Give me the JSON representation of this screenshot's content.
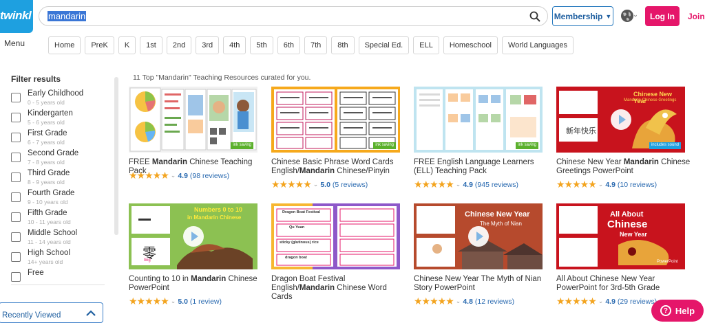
{
  "header": {
    "logo_text": "twinkl",
    "search_value": "mandarin",
    "membership_label": "Membership",
    "login_label": "Log In",
    "join_label": "Join",
    "menu_label": "Menu"
  },
  "grades": [
    "Home",
    "PreK",
    "K",
    "1st",
    "2nd",
    "3rd",
    "4th",
    "5th",
    "6th",
    "7th",
    "8th",
    "Special Ed.",
    "ELL",
    "Homeschool",
    "World Languages"
  ],
  "sidebar": {
    "filter_title": "Filter results",
    "filters": [
      {
        "label": "Early Childhood",
        "sub": "0 - 5 years old"
      },
      {
        "label": "Kindergarten",
        "sub": "5 - 6 years old"
      },
      {
        "label": "First Grade",
        "sub": "6 - 7 years old"
      },
      {
        "label": "Second Grade",
        "sub": "7 - 8 years old"
      },
      {
        "label": "Third Grade",
        "sub": "8 - 9 years old"
      },
      {
        "label": "Fourth Grade",
        "sub": "9 - 10 years old"
      },
      {
        "label": "Fifth Grade",
        "sub": "10 - 11 years old"
      },
      {
        "label": "Middle School",
        "sub": "11 - 14 years old"
      },
      {
        "label": "High School",
        "sub": "14+ years old"
      },
      {
        "label": "Free",
        "sub": ""
      }
    ],
    "recently_viewed": "Recently Viewed"
  },
  "results": {
    "count_text": "11 Top \"Mandarin\" Teaching Resources curated for you.",
    "cards": [
      {
        "pre": "FREE ",
        "bold": "Mandarin",
        "post": " Chinese Teaching Pack",
        "score": "4.9",
        "reviews": "(98 reviews)",
        "badge": "ink saving"
      },
      {
        "pre": "Chinese Basic Phrase Word Cards English/",
        "bold": "Mandarin",
        "post": " Chinese/Pinyin",
        "score": "5.0",
        "reviews": "(5 reviews)",
        "badge": "ink saving"
      },
      {
        "pre": "FREE English Language Learners (ELL) Teaching Pack",
        "bold": "",
        "post": "",
        "score": "4.9",
        "reviews": "(945 reviews)",
        "badge": "ink saving"
      },
      {
        "pre": "Chinese New Year ",
        "bold": "Mandarin",
        "post": " Chinese Greetings PowerPoint",
        "score": "4.9",
        "reviews": "(10 reviews)",
        "badge": "includes sound"
      },
      {
        "pre": "Counting to 10 in ",
        "bold": "Mandarin",
        "post": " Chinese PowerPoint",
        "score": "5.0",
        "reviews": "(1 review)",
        "badge": ""
      },
      {
        "pre": "Dragon Boat Festival English/",
        "bold": "Mandarin",
        "post": " Chinese Word Cards",
        "score": "",
        "reviews": "",
        "badge": ""
      },
      {
        "pre": "Chinese New Year The Myth of Nian Story PowerPoint",
        "bold": "",
        "post": "",
        "score": "4.8",
        "reviews": "(12 reviews)",
        "badge": ""
      },
      {
        "pre": "All About Chinese New Year PowerPoint for 3rd-5th Grade",
        "bold": "",
        "post": "",
        "score": "4.9",
        "reviews": "(29 reviews)",
        "badge": ""
      }
    ],
    "thumb_text": {
      "cny_title": "Chinese New Year",
      "cny_sub": "Mandarin Chinese Greetings",
      "cny_chars": "新年快乐",
      "count_title": "Numbers 0 to 10",
      "count_sub": "in Mandarin Chinese",
      "count_char": "零",
      "count_pinyin": "líng",
      "nian_title": "Chinese New Year",
      "nian_sub": "The Myth of Nian",
      "allabout_1": "All About",
      "allabout_2": "Chinese",
      "allabout_3": "New Year",
      "powerpoint": "PowerPoint",
      "dragon_1": "Dragon Boat Festival",
      "dragon_2": "Qu Yuan",
      "dragon_3": "sticky (glutinous) rice",
      "dragon_4": "dragon boat"
    }
  },
  "help_label": "Help",
  "colors": {
    "brand_blue": "#1ea0e0",
    "accent_pink": "#e5166a",
    "link_blue": "#2a6ab0",
    "star": "#f3a41f"
  }
}
